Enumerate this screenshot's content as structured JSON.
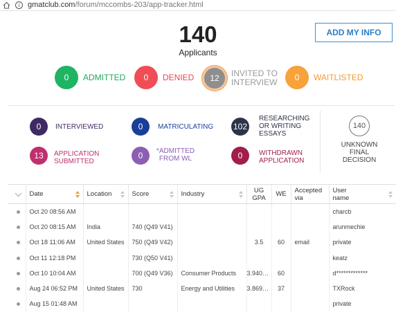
{
  "browser": {
    "url_domain": "gmatclub.com",
    "url_path": "/forum/mccombs-203/app-tracker.html",
    "info_glyph": "i"
  },
  "header": {
    "total": "140",
    "total_label": "Applicants",
    "add_button": "ADD MY INFO"
  },
  "main_stats": {
    "admitted": {
      "count": "0",
      "label": "ADMITTED",
      "color": "#1fb463"
    },
    "denied": {
      "count": "0",
      "label": "DENIED",
      "color": "#f04d55"
    },
    "invited_line1": "INVITED TO",
    "invited_line2": "INTERVIEW",
    "invited_count": "12",
    "waitlisted": {
      "count": "0",
      "label": "WAITLISTED",
      "color": "#f7a23b"
    }
  },
  "sub_stats": {
    "interviewed": {
      "count": "0",
      "label": "INTERVIEWED"
    },
    "matriculating": {
      "count": "0",
      "label": "MATRICULATING"
    },
    "researching": {
      "count": "102",
      "line1": "RESEARCHING",
      "line2": "OR WRITING",
      "line3": "ESSAYS"
    },
    "app_submitted": {
      "count": "13",
      "line1": "APPLICATION",
      "line2": "SUBMITTED"
    },
    "admitted_wl": {
      "count": "0",
      "line1": "*ADMITTED",
      "line2": "FROM WL"
    },
    "withdrawn": {
      "count": "0",
      "line1": "WITHDRAWN",
      "line2": "APPLICATION"
    },
    "unknown": {
      "count": "140",
      "line1": "UNKNOWN",
      "line2": "FINAL",
      "line3": "DECISION"
    }
  },
  "table": {
    "headers": {
      "date": "Date",
      "location": "Location",
      "score": "Score",
      "industry": "Industry",
      "gpa1": "UG",
      "gpa2": "GPA",
      "we": "WE",
      "accepted1": "Accepted",
      "accepted2": "via",
      "user1": "User",
      "user2": "name"
    },
    "rows": [
      {
        "date": "Oct 20 08:56 AM",
        "location": "",
        "score": "",
        "industry": "",
        "gpa": "",
        "we": "",
        "via": "",
        "user": "charcb"
      },
      {
        "date": "Oct 20 08:15 AM",
        "location": "India",
        "score": "740 (Q49 V41)",
        "industry": "",
        "gpa": "",
        "we": "",
        "via": "",
        "user": "arunmechie"
      },
      {
        "date": "Oct 18 11:06 AM",
        "location": "United States",
        "score": "750 (Q49 V42)",
        "industry": "",
        "gpa": "3.5",
        "we": "60",
        "via": "email",
        "user": "private"
      },
      {
        "date": "Oct 11 12:18 PM",
        "location": "",
        "score": "730 (Q50 V41)",
        "industry": "",
        "gpa": "",
        "we": "",
        "via": "",
        "user": "keatz"
      },
      {
        "date": "Oct 10 10:04 AM",
        "location": "",
        "score": "700 (Q49 V36)",
        "industry": "Consumer Products",
        "gpa": "3.9400...",
        "we": "60",
        "via": "",
        "user": "d*************"
      },
      {
        "date": "Aug 24 06:52 PM",
        "location": "United States",
        "score": "730",
        "industry": "Energy and Utilities",
        "gpa": "3.8699...",
        "we": "37",
        "via": "",
        "user": "TXRock"
      },
      {
        "date": "Aug 15 01:48 AM",
        "location": "",
        "score": "",
        "industry": "",
        "gpa": "",
        "we": "",
        "via": "",
        "user": "private"
      }
    ]
  }
}
